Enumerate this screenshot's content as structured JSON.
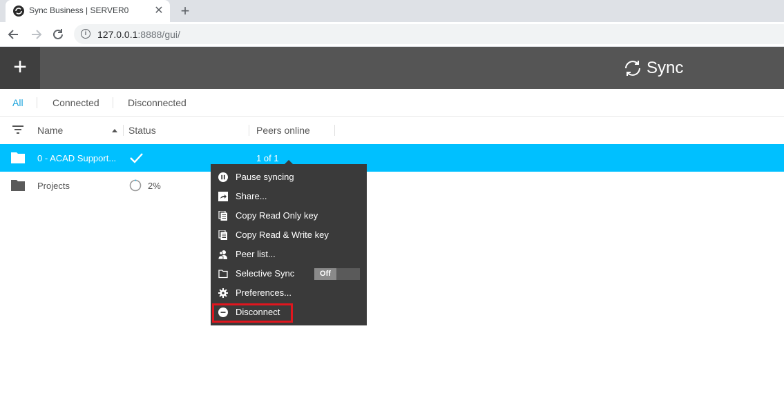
{
  "browser": {
    "tab_title": "Sync Business | SERVER0",
    "new_tab_label": "+",
    "url_host": "127.0.0.1",
    "url_rest": ":8888/gui/"
  },
  "app": {
    "add_label": "+",
    "brand": "Sync"
  },
  "filters": [
    {
      "label": "All",
      "active": true
    },
    {
      "label": "Connected",
      "active": false
    },
    {
      "label": "Disconnected",
      "active": false
    }
  ],
  "columns": {
    "name": "Name",
    "status": "Status",
    "peers": "Peers online"
  },
  "rows": [
    {
      "name": "0 - ACAD Support...",
      "status": "synced",
      "peers": "1 of 1",
      "selected": true
    },
    {
      "name": "Projects",
      "status": "syncing",
      "progress_text": "2%",
      "progress": 0.02,
      "selected": false
    }
  ],
  "menu": {
    "items": [
      {
        "label": "Pause syncing",
        "icon": "pause-icon"
      },
      {
        "label": "Share...",
        "icon": "share-icon"
      },
      {
        "label": "Copy Read Only key",
        "icon": "copy-icon"
      },
      {
        "label": "Copy Read & Write key",
        "icon": "copy-icon"
      },
      {
        "label": "Peer list...",
        "icon": "peers-icon"
      },
      {
        "label": "Selective Sync",
        "icon": "folder-outline-icon",
        "toggle": "Off"
      },
      {
        "label": "Preferences...",
        "icon": "gear-icon"
      },
      {
        "label": "Disconnect",
        "icon": "disconnect-icon",
        "highlighted": true
      }
    ]
  },
  "colors": {
    "accent": "#00c0ff",
    "header": "#555555",
    "menu_bg": "#3a3a3a",
    "highlight": "#e0161e"
  }
}
